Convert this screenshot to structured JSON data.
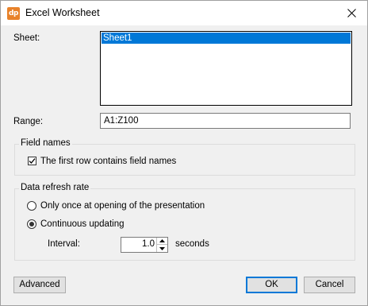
{
  "window": {
    "title": "Excel Worksheet",
    "icon_text": "dp",
    "icon_color": "#e8822a"
  },
  "sheet": {
    "label": "Sheet:",
    "items": [
      "Sheet1"
    ],
    "selected": "Sheet1"
  },
  "range": {
    "label": "Range:",
    "value": "A1:Z100"
  },
  "field_names": {
    "group_title": "Field names",
    "checkbox_label": "The first row contains field names",
    "checked": true
  },
  "refresh": {
    "group_title": "Data refresh rate",
    "option_once": "Only once at opening of the presentation",
    "option_continuous": "Continuous updating",
    "selected": "continuous",
    "interval_label": "Interval:",
    "interval_value": "1.0",
    "interval_unit": "seconds"
  },
  "buttons": {
    "advanced": "Advanced",
    "ok": "OK",
    "cancel": "Cancel"
  },
  "colors": {
    "accent": "#0078d7",
    "dialog_bg": "#f0f0f0"
  }
}
